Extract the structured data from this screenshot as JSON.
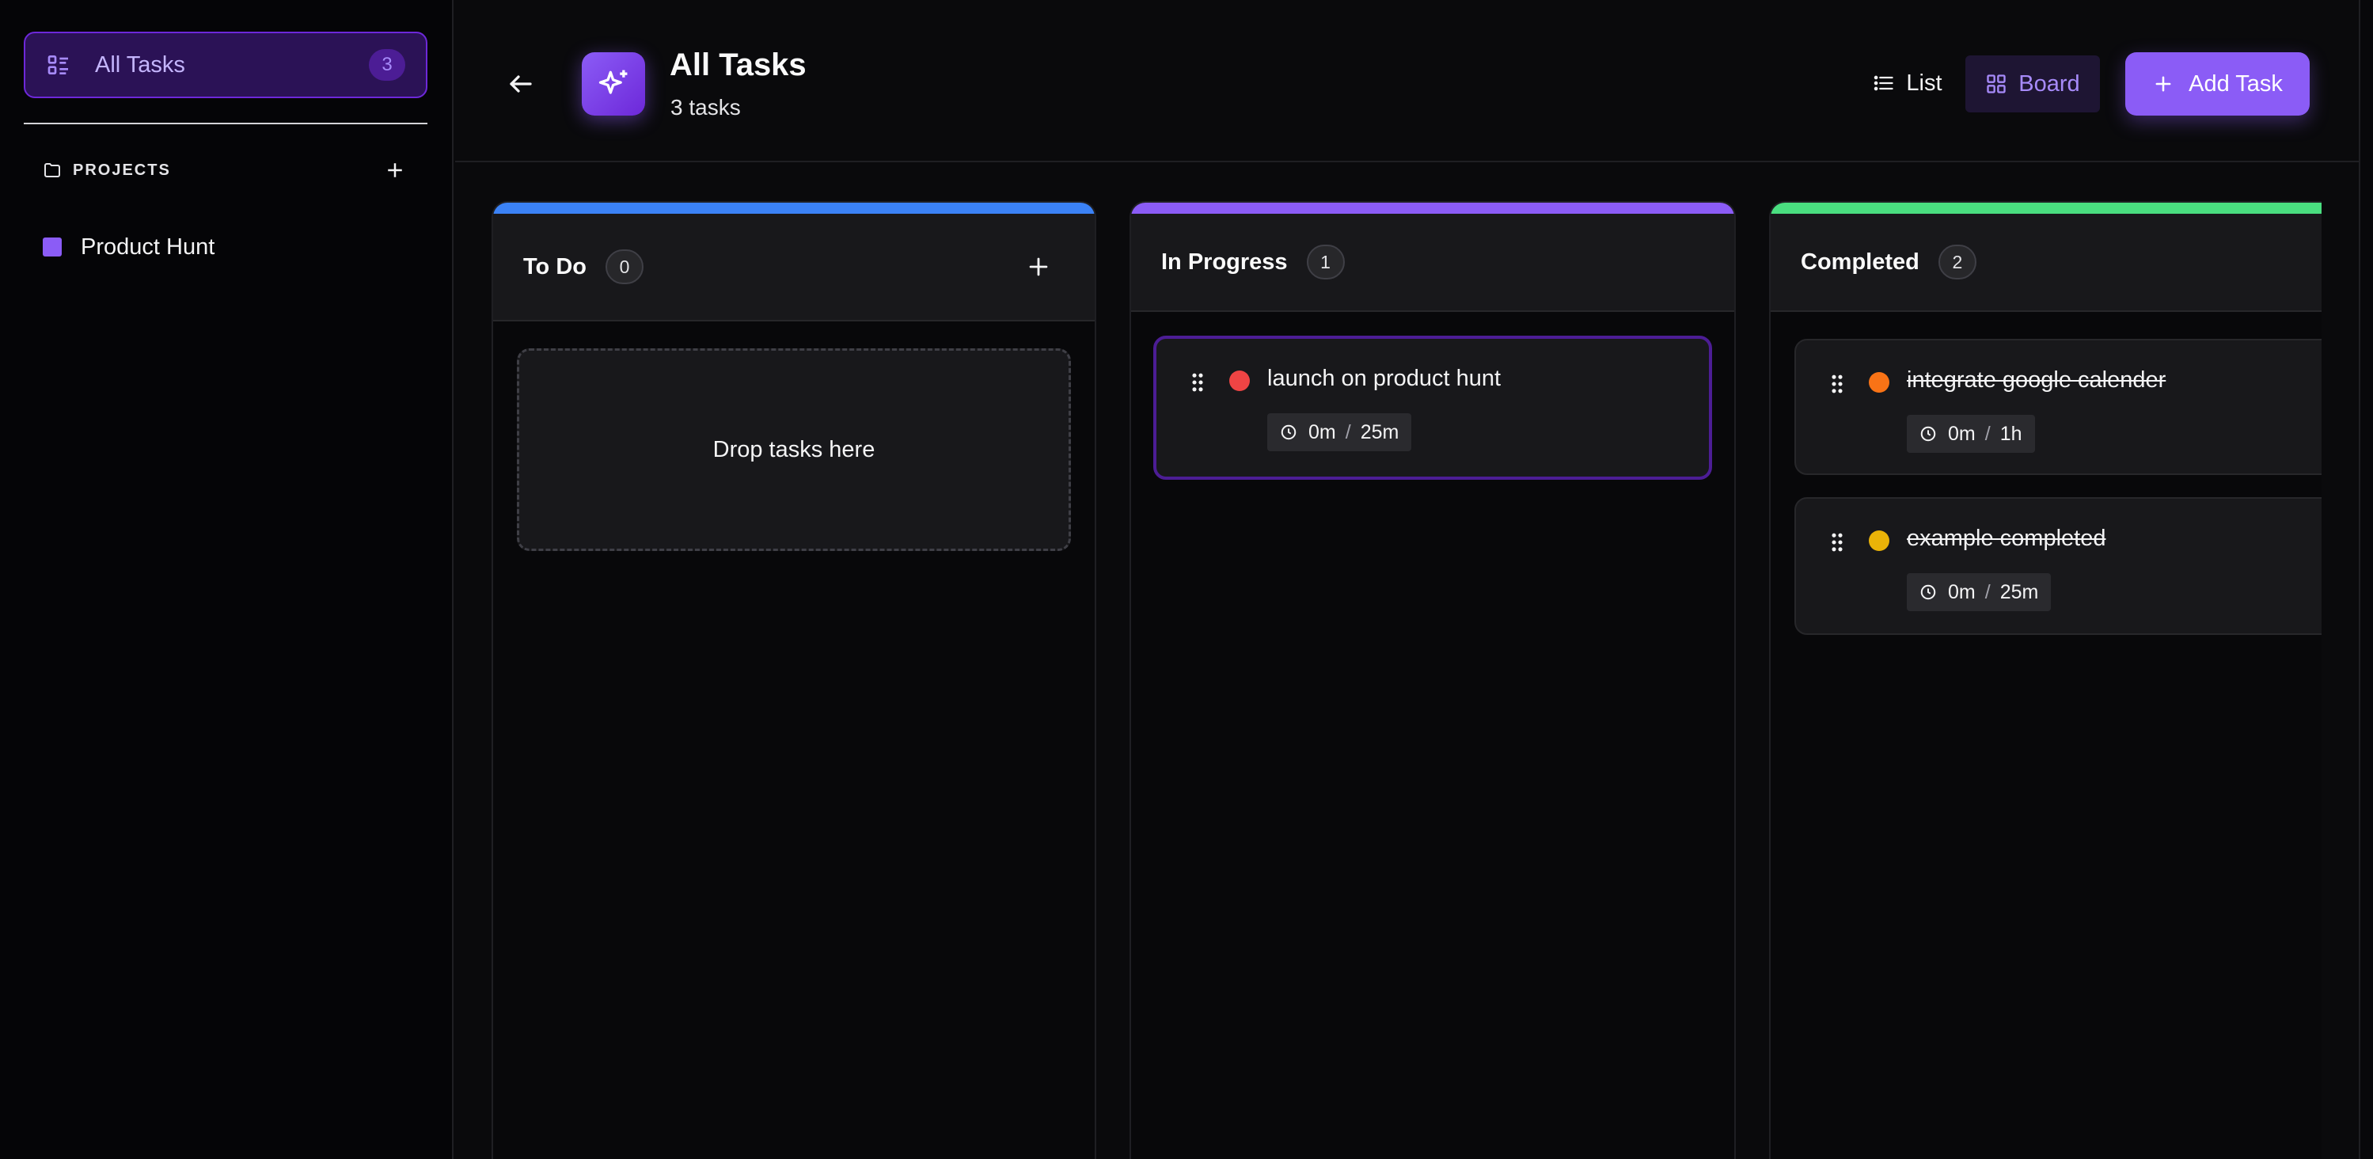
{
  "sidebar": {
    "all_tasks": {
      "label": "All Tasks",
      "count": "3"
    },
    "projects_label": "PROJECTS",
    "projects": [
      {
        "label": "Product Hunt",
        "color": "#8b5cf6"
      }
    ]
  },
  "header": {
    "title": "All Tasks",
    "subtitle": "3 tasks",
    "view_list_label": "List",
    "view_board_label": "Board",
    "add_task_label": "Add Task"
  },
  "columns": [
    {
      "title": "To Do",
      "count": "0",
      "accent": "#3b82f6",
      "empty_text": "Drop tasks here"
    },
    {
      "title": "In Progress",
      "count": "1",
      "accent": "#8b5cf6"
    },
    {
      "title": "Completed",
      "count": "2",
      "accent": "#4ade80"
    }
  ],
  "tasks": {
    "in_progress": [
      {
        "name": "launch on product hunt",
        "priority_color": "#ef4444",
        "spent": "0m",
        "estimate": "25m"
      }
    ],
    "completed": [
      {
        "name": "integrate google calender",
        "priority_color": "#f97316",
        "spent": "0m",
        "estimate": "1h"
      },
      {
        "name": "example completed",
        "priority_color": "#eab308",
        "spent": "0m",
        "estimate": "25m"
      }
    ]
  },
  "time_separator": "/"
}
